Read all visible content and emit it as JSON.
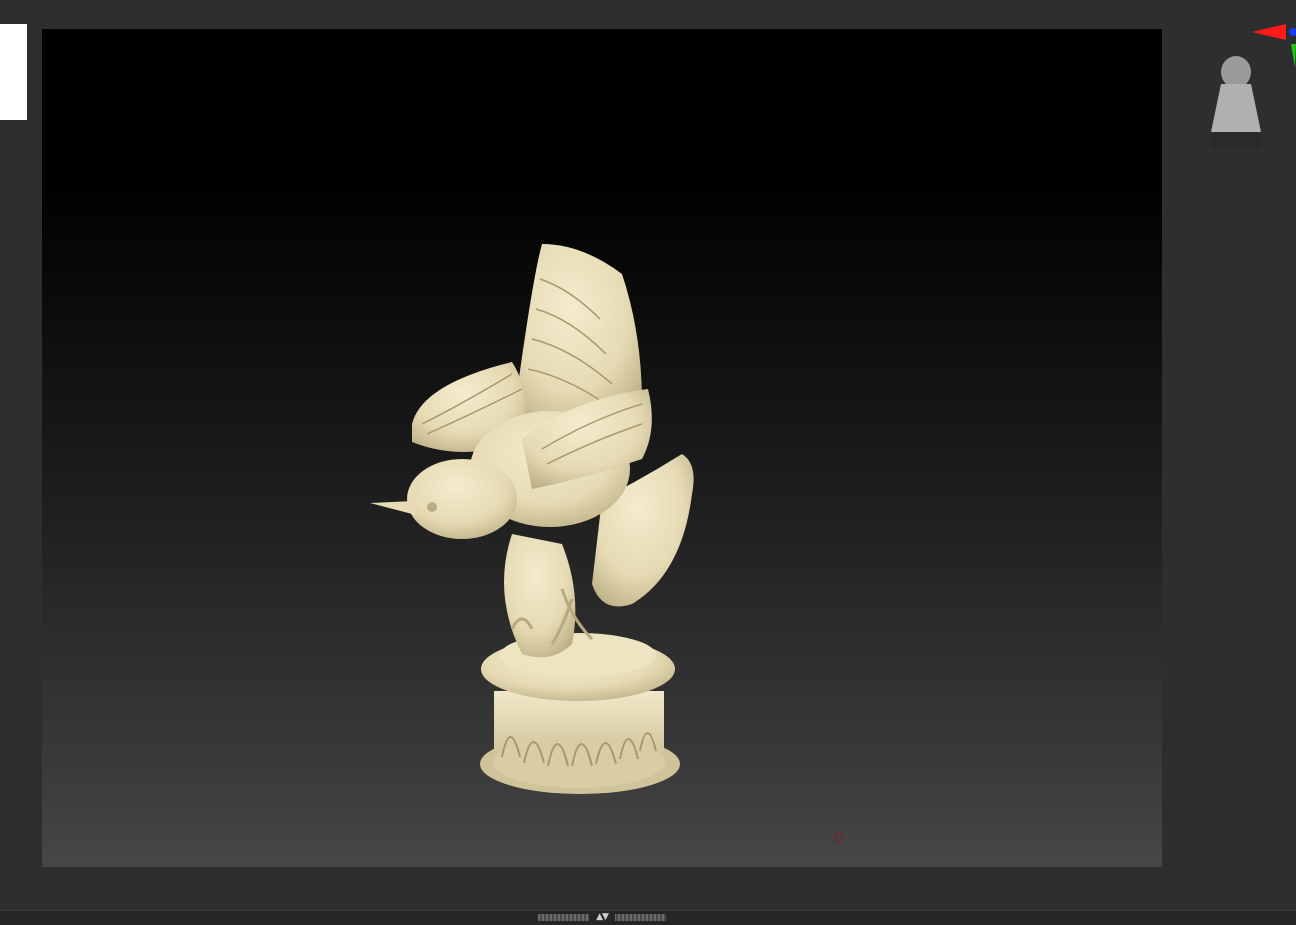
{
  "app": {
    "left_tab_icon": "tray-tab",
    "viewport_icon": "sculpt-model",
    "gizmo_icon": "navigation-gizmo-icon",
    "model_color": "#e9dfb9",
    "background_top": "#000000",
    "background_bottom": "#474747"
  },
  "bottom_tray": {
    "arrows": "▲▼",
    "icon": "tray-toggle-icon"
  }
}
